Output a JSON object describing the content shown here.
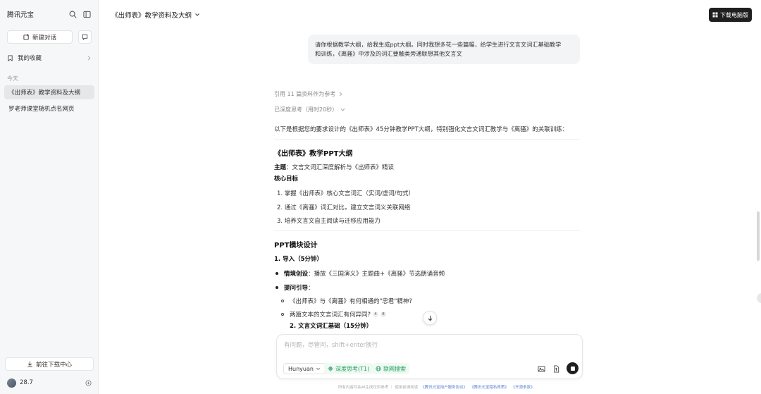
{
  "sidebar": {
    "brand": "腾讯元宝",
    "new_chat": "新建对话",
    "favorites": "我的收藏",
    "section_today": "今天",
    "history": [
      "《出师表》教学资料及大纲",
      "罗老师课堂随机点名网页"
    ],
    "download_center": "前往下载中心",
    "user_name": "28.7"
  },
  "header": {
    "title": "《出师表》教学资料及大纲",
    "download_pc": "下载电脑版"
  },
  "user_message": {
    "line1": "请你根据教学大纲，给我生成ppt大纲。同时我想多花一些篇幅，给学生进行文言文词汇基础教学",
    "line2": "和训练，《离骚》中涉及的词汇要触类旁通联想其他文言文"
  },
  "assistant": {
    "refs": "引用 11 篇资料作为参考",
    "thought": "已深度思考（用时20秒）",
    "intro": "以下是根据您的要求设计的《出师表》45分钟教学PPT大纲，特别强化文言文词汇教学与《离骚》的关联训练：",
    "h_outline": "《出师表》教学PPT大纲",
    "theme_label": "主题",
    "theme_text": "：文言文词汇深度解析与《出师表》精读",
    "core_goals": "核心目标",
    "goals": [
      "1. 掌握《出师表》核心文言词汇（实词/虚词/句式）",
      "2. 通过《离骚》词汇对比，建立文言词义关联网络",
      "3. 培养文言文自主阅读与迁移应用能力"
    ],
    "h_modules": "PPT模块设计",
    "m1_title": "1. 导入（5分钟）",
    "m1_b1_label": "情境创设",
    "m1_b1_text": "：播放《三国演义》主题曲+《离骚》节选朗诵音频",
    "m1_b2_label": "提问引导",
    "m1_b2_text": "：",
    "m1_sub1": "《出师表》与《离骚》有何相通的\"忠君\"精神?",
    "m1_sub2": "两篇文本的文言词汇有何异同?",
    "cite_a": "4",
    "cite_b": "8",
    "m2_title": "2. 文言文词汇基础（15分钟）"
  },
  "input": {
    "placeholder": "有问题，尽管问，shift+enter换行",
    "model": "Hunyuan",
    "deep_think": "深度思考(T1)",
    "web_search": "联网搜索"
  },
  "footer": {
    "notice": "所有内容均由AI生成仅供参考 ｜ 使用前请阅读",
    "link1": "《腾讯元宝用户服务协议》",
    "link2": "《腾讯元宝隐私政策》",
    "link3": "《开源条款》"
  }
}
